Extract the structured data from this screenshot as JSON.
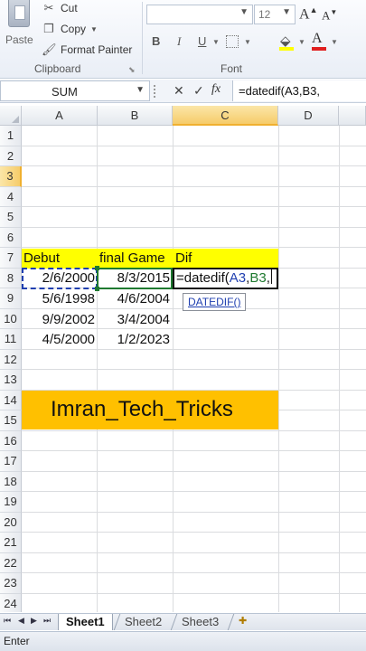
{
  "ribbon": {
    "clipboard": {
      "paste_label": "Paste",
      "cut_label": "Cut",
      "copy_label": "Copy",
      "format_painter_label": "Format Painter",
      "group_label": "Clipboard"
    },
    "font": {
      "font_name": "",
      "font_size": "12",
      "grow_label": "A",
      "shrink_label": "A",
      "bold_label": "B",
      "italic_label": "I",
      "underline_label": "U",
      "font_color_label": "A",
      "group_label": "Font",
      "fill_color": "#ffff00",
      "font_color": "#e02020"
    }
  },
  "formula_bar": {
    "name_box": "SUM",
    "cancel_symbol": "✕",
    "enter_symbol": "✓",
    "fx_label": "fx",
    "formula": "=datedif(A3,B3,"
  },
  "columns": [
    "A",
    "B",
    "C",
    "D"
  ],
  "active_column": "C",
  "rows": [
    "1",
    "2",
    "3",
    "4",
    "5",
    "6",
    "7",
    "8",
    "9",
    "10",
    "11",
    "12",
    "13",
    "14",
    "15",
    "16",
    "17",
    "18",
    "19",
    "20",
    "21",
    "22",
    "23",
    "24"
  ],
  "active_row": "3",
  "cells": {
    "A2": "Debut",
    "B2": "final Game",
    "C2": "Dif",
    "A3": "2/6/2000",
    "B3": "8/3/2015",
    "A4": "5/6/1998",
    "B4": "4/6/2004",
    "A5": "9/9/2002",
    "B5": "3/4/2004",
    "A6": "4/5/2000",
    "B6": "1/2/2023"
  },
  "editing_cell": {
    "prefix": "=datedif(",
    "ref1": "A3",
    "sep1": ",",
    "ref2": "B3",
    "sep2": ","
  },
  "tooltip": "DATEDIF()",
  "brand_text": "Imran_Tech_Tricks",
  "colors": {
    "header_yellow": "#ffff00",
    "brand_orange": "#ffc000",
    "ref_blue": "#1f3fb0",
    "ref_green": "#1f7a30"
  },
  "sheet_tabs": [
    "Sheet1",
    "Sheet2",
    "Sheet3"
  ],
  "active_sheet": "Sheet1",
  "status": "Enter"
}
